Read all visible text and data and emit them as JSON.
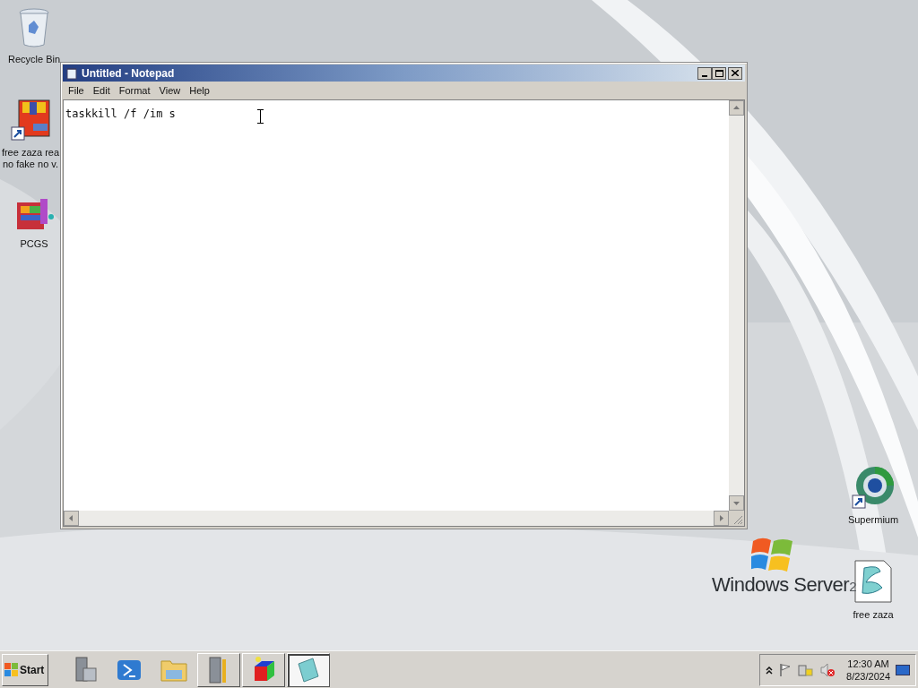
{
  "desktop_icons": [
    {
      "kind": "recycle",
      "label_lines": [
        "Recycle Bin"
      ]
    },
    {
      "kind": "package",
      "label_lines": [
        "free zaza rea",
        "no fake no v."
      ]
    },
    {
      "kind": "blocks",
      "label_lines": [
        "PCGS"
      ]
    },
    {
      "kind": "browser",
      "label_lines": [
        "Supermium"
      ]
    },
    {
      "kind": "script",
      "label_lines": [
        "free zaza"
      ]
    }
  ],
  "wallpaper": {
    "logo_text": "Windows Server",
    "logo_version": "2"
  },
  "window": {
    "title": "Untitled - Notepad",
    "menu": [
      "File",
      "Edit",
      "Format",
      "View",
      "Help"
    ],
    "content": "taskkill /f /im s"
  },
  "taskbar": {
    "start": "Start",
    "items": [
      {
        "kind": "server",
        "running": false,
        "selected": false
      },
      {
        "kind": "shell",
        "running": false,
        "selected": false
      },
      {
        "kind": "folder",
        "running": false,
        "selected": false
      },
      {
        "kind": "tools",
        "running": true,
        "selected": false
      },
      {
        "kind": "cube",
        "running": true,
        "selected": false
      },
      {
        "kind": "notepad",
        "running": true,
        "selected": true
      }
    ],
    "clock": {
      "time": "12:30 AM",
      "date": "8/23/2024"
    }
  }
}
